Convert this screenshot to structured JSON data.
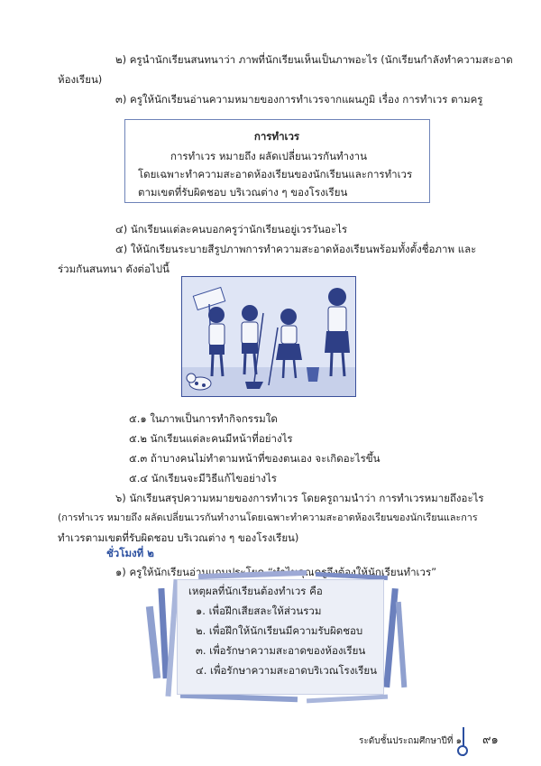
{
  "paragraphs": {
    "p2_line1": "๒) ครูนำนักเรียนสนทนาว่า ภาพที่นักเรียนเห็นเป็นภาพอะไร (นักเรียนกำลังทำความสะอาด",
    "p2_line2": "ห้องเรียน)",
    "p3": "๓) ครูให้นักเรียนอ่านความหมายของการทำเวรจากแผนภูมิ เรื่อง การทำเวร ตามครู",
    "p4": "๔) นักเรียนแต่ละคนบอกครูว่านักเรียนอยู่เวรวันอะไร",
    "p5_line1": "๕) ให้นักเรียนระบายสีรูปภาพการทำความสะอาดห้องเรียนพร้อมทั้งตั้งชื่อภาพ และ",
    "p5_line2": "ร่วมกันสนทนา ดังต่อไปนี้",
    "q51": "๕.๑ ในภาพเป็นการทำกิจกรรมใด",
    "q52": "๕.๒ นักเรียนแต่ละคนมีหน้าที่อย่างไร",
    "q53": "๕.๓ ถ้าบางคนไม่ทำตามหน้าที่ของตนเอง จะเกิดอะไรขึ้น",
    "q54": "๕.๔ นักเรียนจะมีวิธีแก้ไขอย่างไร",
    "p6_line1": "๖) นักเรียนสรุปความหมายของการทำเวร โดยครูถามนำว่า การทำเวรหมายถึงอะไร",
    "p6_line2": "(การทำเวร หมายถึง ผลัดเปลี่ยนเวรกันทำงานโดยเฉพาะทำความสะอาดห้องเรียนของนักเรียนและการ",
    "p6_line3": "ทำเวรตามเขตที่รับผิดชอบ บริเวณต่าง ๆ ของโรงเรียน)",
    "hour_heading": "ชั่วโมงที่ ๒",
    "h2_p1": "๑) ครูให้นักเรียนอ่านแถบประโยค “ทำไมคุณครูจึงต้องให้นักเรียนทำเวร”"
  },
  "definition_box": {
    "title": "การทำเวร",
    "line1": "การทำเวร หมายถึง ผลัดเปลี่ยนเวรกันทำงาน",
    "line2": "โดยเฉพาะทำความสะอาดห้องเรียนของนักเรียนและการทำเวร",
    "line3": "ตามเขตที่รับผิดชอบ บริเวณต่าง ๆ ของโรงเรียน"
  },
  "reasons_box": {
    "title": "เหตุผลที่นักเรียนต้องทำเวร คือ",
    "items": [
      "๑. เพื่อฝึกเสียสละให้ส่วนรวม",
      "๒. เพื่อฝึกให้นักเรียนมีความรับผิดชอบ",
      "๓. เพื่อรักษาความสะอาดของห้องเรียน",
      "๔. เพื่อรักษาความสะอาดบริเวณโรงเรียน"
    ]
  },
  "footer": {
    "grade": "ระดับชั้นประถมศึกษาปีที่ ๑",
    "page": "๙๑"
  },
  "colors": {
    "accent": "#2b4fa0",
    "box_border": "#6e83b8"
  }
}
